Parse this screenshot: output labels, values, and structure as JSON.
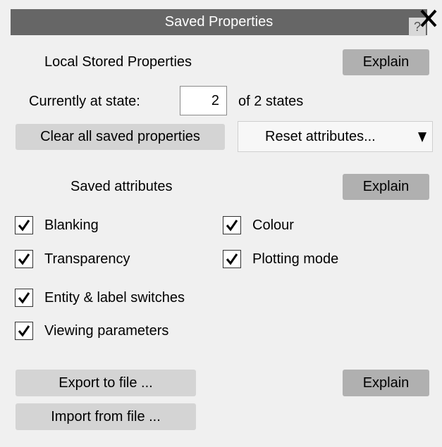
{
  "window": {
    "title": "Saved Properties",
    "help_label": "?"
  },
  "local": {
    "heading": "Local Stored Properties",
    "explain_label": "Explain",
    "state_label": "Currently at state:",
    "state_value": "2",
    "state_suffix": "of 2 states",
    "clear_label": "Clear all saved properties",
    "reset_label": "Reset attributes..."
  },
  "attributes": {
    "heading": "Saved attributes",
    "explain_label": "Explain",
    "items": [
      {
        "label": "Blanking",
        "checked": true
      },
      {
        "label": "Colour",
        "checked": true
      },
      {
        "label": "Transparency",
        "checked": true
      },
      {
        "label": "Plotting mode",
        "checked": true
      },
      {
        "label": "Entity & label switches",
        "checked": true
      },
      {
        "label": "Viewing parameters",
        "checked": true
      }
    ]
  },
  "file": {
    "export_label": "Export to file ...",
    "import_label": "Import from file ...",
    "explain_label": "Explain"
  }
}
